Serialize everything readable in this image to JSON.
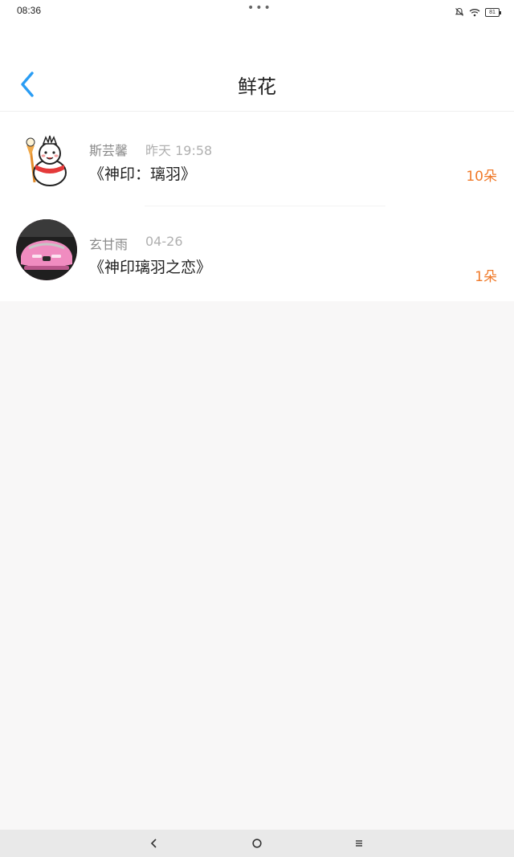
{
  "status_bar": {
    "time": "08:36",
    "battery": "81",
    "icons": [
      "mute-bell-icon",
      "wifi-icon",
      "battery-icon"
    ]
  },
  "header": {
    "title": "鲜花",
    "back_icon": "chevron-left-icon"
  },
  "flowers": [
    {
      "name": "斯芸馨",
      "time": "昨天 19:58",
      "book": "《神印：璃羽》",
      "count": "10朵",
      "avatar": "snowman-avatar"
    },
    {
      "name": "玄甘雨",
      "time": "04-26",
      "book": "《神印璃羽之恋》",
      "count": "1朵",
      "avatar": "pink-car-avatar"
    }
  ],
  "nav_bar": {
    "buttons": [
      "back-nav-icon",
      "home-nav-icon",
      "menu-nav-icon"
    ]
  },
  "colors": {
    "accent": "#2a9df4",
    "count": "#f07a2a",
    "background": "#f8f7f7"
  }
}
